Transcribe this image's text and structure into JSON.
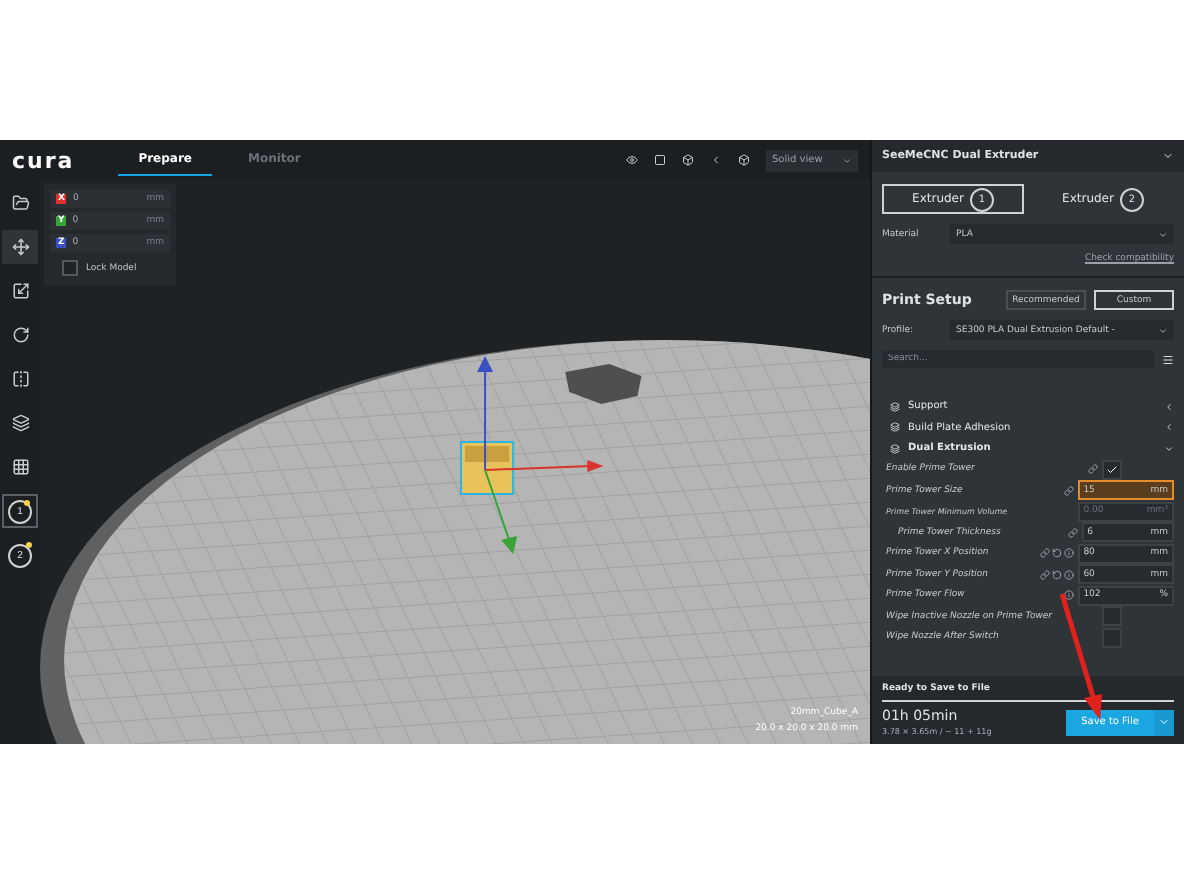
{
  "header": {
    "logo": "cura",
    "tabs": [
      {
        "label": "Prepare",
        "selected": true
      },
      {
        "label": "Monitor",
        "selected": false
      }
    ],
    "view_mode": "Solid view"
  },
  "move_panel": {
    "fields": [
      {
        "axis": "X",
        "value": "0",
        "unit": "mm",
        "color": "#d9332b"
      },
      {
        "axis": "Y",
        "value": "0",
        "unit": "mm",
        "color": "#39a339"
      },
      {
        "axis": "Z",
        "value": "0",
        "unit": "mm",
        "color": "#3b4fc2"
      }
    ],
    "lock_model": {
      "label": "Lock Model",
      "checked": false
    }
  },
  "extruder_toolbar": [
    {
      "number": "1",
      "selected": true
    },
    {
      "number": "2",
      "selected": false
    }
  ],
  "model_info": {
    "name": "20mm_Cube_A",
    "dimensions": "20.0 x 20.0 x 20.0 mm"
  },
  "sidebar": {
    "printer": "SeeMeCNC Dual Extruder",
    "extruders": [
      {
        "label": "Extruder",
        "number": "1",
        "selected": true
      },
      {
        "label": "Extruder",
        "number": "2",
        "selected": false
      }
    ],
    "material": {
      "label": "Material",
      "value": "PLA"
    },
    "check_link": "Check compatibility",
    "print_setup": {
      "title": "Print Setup",
      "modes": [
        {
          "label": "Recommended",
          "selected": false
        },
        {
          "label": "Custom",
          "selected": true
        }
      ],
      "profile": {
        "label": "Profile:",
        "value": "SE300 PLA Dual Extrusion Default -"
      },
      "search": {
        "placeholder": "Search..."
      }
    },
    "categories": [
      {
        "label": "Support",
        "expanded": false
      },
      {
        "label": "Build Plate Adhesion",
        "expanded": false
      },
      {
        "label": "Dual Extrusion",
        "expanded": true,
        "settings": [
          {
            "kind": "checkbox",
            "label": "Enable Prime Tower",
            "checked": true,
            "linked": true,
            "overridden": false,
            "info": false
          },
          {
            "kind": "number",
            "label": "Prime Tower Size",
            "value": "15",
            "unit": "mm",
            "warning": true,
            "disabled": false,
            "linked": true,
            "overridden": false,
            "info": false
          },
          {
            "kind": "number",
            "label": "Prime Tower Minimum Volume",
            "value": "0.00",
            "unit": "mm³",
            "warning": false,
            "disabled": true,
            "linked": false,
            "overridden": false,
            "info": false,
            "children": [
              {
                "kind": "number",
                "label": "Prime Tower Thickness",
                "value": "6",
                "unit": "mm",
                "warning": false,
                "disabled": false,
                "linked": true,
                "overridden": false,
                "info": false
              }
            ]
          },
          {
            "kind": "number",
            "label": "Prime Tower X Position",
            "value": "80",
            "unit": "mm",
            "warning": false,
            "disabled": false,
            "linked": true,
            "overridden": true,
            "info": true
          },
          {
            "kind": "number",
            "label": "Prime Tower Y Position",
            "value": "60",
            "unit": "mm",
            "warning": false,
            "disabled": false,
            "linked": true,
            "overridden": true,
            "info": true
          },
          {
            "kind": "number",
            "label": "Prime Tower Flow",
            "value": "102",
            "unit": "%",
            "warning": false,
            "disabled": false,
            "linked": false,
            "overridden": false,
            "info": true
          },
          {
            "kind": "checkbox",
            "label": "Wipe Inactive Nozzle on Prime Tower",
            "checked": false,
            "linked": false,
            "overridden": false,
            "info": false
          },
          {
            "kind": "checkbox",
            "label": "Wipe Nozzle After Switch",
            "checked": false,
            "linked": false,
            "overridden": false,
            "info": false
          }
        ]
      }
    ],
    "footer": {
      "status": "Ready to Save to File",
      "level": 1,
      "time": "01h 05min",
      "usage": "3.78 × 3.65m / ~ 11 + 11g",
      "save_button": "Save to File"
    }
  }
}
